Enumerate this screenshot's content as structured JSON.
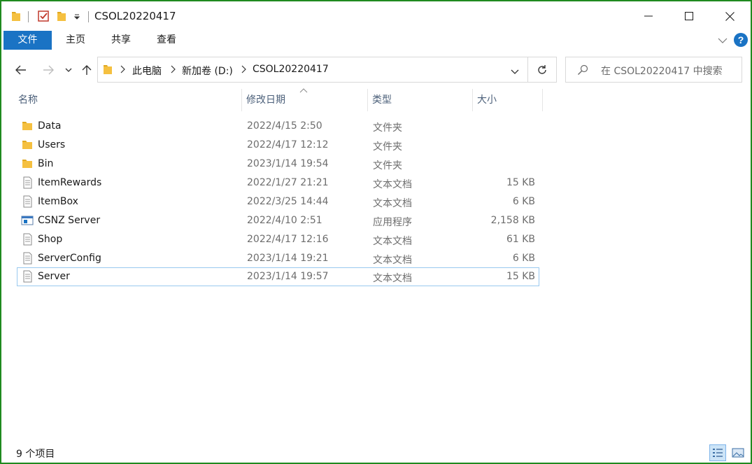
{
  "window": {
    "title": "CSOL20220417",
    "minimize_glyph": "—",
    "maximize_glyph": "☐",
    "close_glyph": "✕"
  },
  "ribbon": {
    "tabs": [
      "文件",
      "主页",
      "共享",
      "查看"
    ]
  },
  "address": {
    "crumbs": [
      "此电脑",
      "新加卷 (D:)",
      "CSOL20220417"
    ]
  },
  "search": {
    "placeholder": "在 CSOL20220417 中搜索"
  },
  "columns": {
    "name": "名称",
    "date": "修改日期",
    "type": "类型",
    "size": "大小"
  },
  "files": [
    {
      "name": "Data",
      "date": "2022/4/15 2:50",
      "type": "文件夹",
      "size": "",
      "icon": "folder-icon"
    },
    {
      "name": "Users",
      "date": "2022/4/17 12:12",
      "type": "文件夹",
      "size": "",
      "icon": "folder-icon"
    },
    {
      "name": "Bin",
      "date": "2023/1/14 19:54",
      "type": "文件夹",
      "size": "",
      "icon": "folder-icon"
    },
    {
      "name": "ItemRewards",
      "date": "2022/1/27 21:21",
      "type": "文本文档",
      "size": "15 KB",
      "icon": "text-file-icon"
    },
    {
      "name": "ItemBox",
      "date": "2022/3/25 14:44",
      "type": "文本文档",
      "size": "6 KB",
      "icon": "text-file-icon"
    },
    {
      "name": "CSNZ Server",
      "date": "2022/4/10 2:51",
      "type": "应用程序",
      "size": "2,158 KB",
      "icon": "application-icon"
    },
    {
      "name": "Shop",
      "date": "2022/4/17 12:16",
      "type": "文本文档",
      "size": "61 KB",
      "icon": "text-file-icon"
    },
    {
      "name": "ServerConfig",
      "date": "2023/1/14 19:21",
      "type": "文本文档",
      "size": "6 KB",
      "icon": "text-file-icon"
    },
    {
      "name": "Server",
      "date": "2023/1/14 19:57",
      "type": "文本文档",
      "size": "15 KB",
      "icon": "text-file-icon"
    }
  ],
  "status": {
    "item_count": "9 个项目"
  },
  "colors": {
    "accent": "#1a73c4",
    "frame": "#1f8a1f",
    "folder": "#f5c040",
    "selection_border": "#99c9ef",
    "help": "#1a73c4"
  }
}
